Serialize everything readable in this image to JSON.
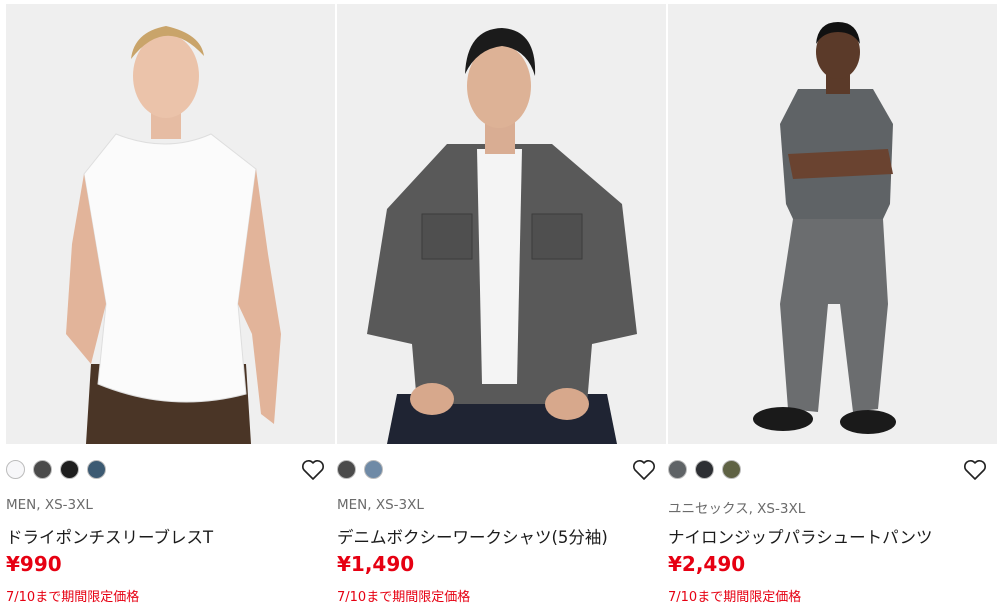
{
  "products": [
    {
      "image": "product-photo-sleeveless-tank",
      "colors": [
        "#f7f7f9",
        "#4b4b4b",
        "#1e1e1e",
        "#3c5a72"
      ],
      "sizes": "MEN, XS-3XL",
      "name": "ドライポンチスリーブレスT",
      "price": "¥990",
      "promo": "7/10まで期間限定価格",
      "favorite_icon": "heart-outline-icon"
    },
    {
      "image": "product-photo-denim-shirt",
      "colors": [
        "#4b4b4b",
        "#6f8aa6"
      ],
      "sizes": "MEN, XS-3XL",
      "name": "デニムボクシーワークシャツ(5分袖)",
      "price": "¥1,490",
      "promo": "7/10まで期間限定価格",
      "favorite_icon": "heart-outline-icon"
    },
    {
      "image": "product-photo-parachute-pants",
      "colors": [
        "#5f6366",
        "#2d2f33",
        "#5f6244"
      ],
      "sizes": "ユニセックス, XS-3XL",
      "name": "ナイロンジップパラシュートパンツ",
      "price": "¥2,490",
      "promo": "7/10まで期間限定価格",
      "favorite_icon": "heart-outline-icon"
    }
  ]
}
